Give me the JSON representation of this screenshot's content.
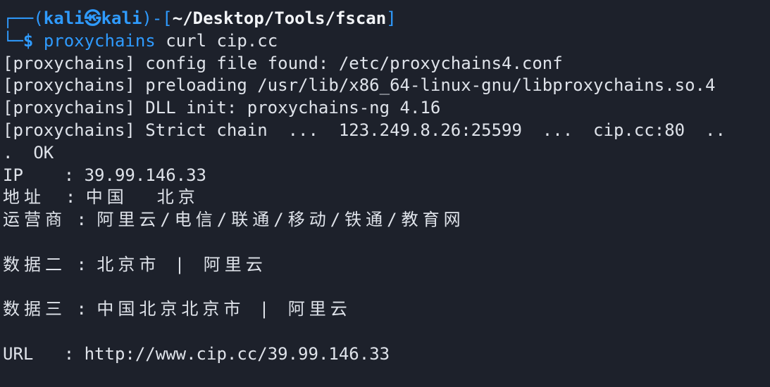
{
  "prompt": {
    "box_top": "┌──(",
    "user": "kali",
    "skull": "㉿",
    "host": "kali",
    "box_mid": ")-[",
    "cwd": "~/Desktop/Tools/fscan",
    "box_end": "]",
    "box_bottom": "└─",
    "dollar": "$",
    "command": "proxychains",
    "args": " curl cip.cc"
  },
  "output": {
    "line1": "[proxychains] config file found: /etc/proxychains4.conf",
    "line2": "[proxychains] preloading /usr/lib/x86_64-linux-gnu/libproxychains.so.4",
    "line3": "[proxychains] DLL init: proxychains-ng 4.16",
    "line4": "[proxychains] Strict chain  ...  123.249.8.26:25599  ...  cip.cc:80  ..",
    "line5": ".  OK",
    "ip_label": "IP",
    "ip_sep": "    : ",
    "ip_value": "39.99.146.33",
    "addr_label": "地址",
    "addr_sep": "  : ",
    "addr_value": "中国  北京",
    "isp_label": "运营商",
    "isp_sep": " : ",
    "isp_value": "阿里云/电信/联通/移动/铁通/教育网",
    "data2_label": "数据二",
    "data2_sep": " : ",
    "data2_value": "北京市 | 阿里云",
    "data3_label": "数据三",
    "data3_sep": " : ",
    "data3_value": "中国北京北京市 | 阿里云",
    "url_label": "URL",
    "url_sep": "   : ",
    "url_value": "http://www.cip.cc/39.99.146.33"
  },
  "colors": {
    "background": "#1d212b",
    "text": "#dfe3ea",
    "accent": "#2f9bff"
  }
}
